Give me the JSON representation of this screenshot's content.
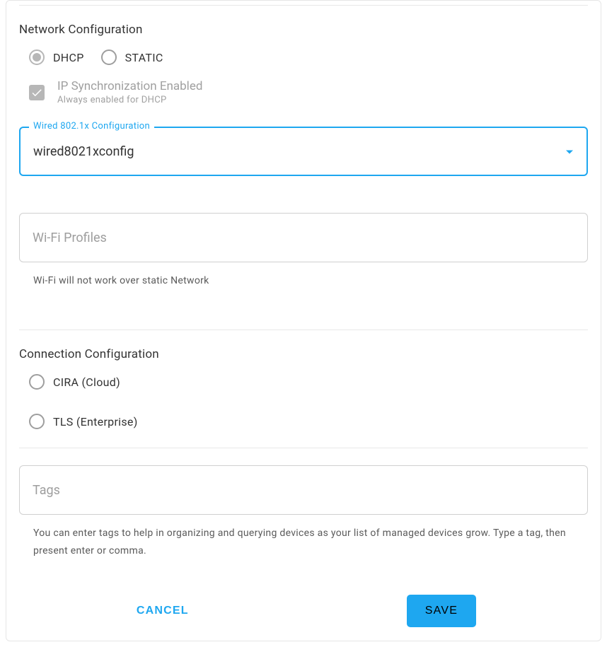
{
  "network": {
    "title": "Network Configuration",
    "options": {
      "dhcp": "DHCP",
      "static": "STATIC"
    },
    "ip_sync": {
      "label": "IP Synchronization Enabled",
      "sub": "Always enabled for DHCP"
    },
    "wired": {
      "label": "Wired 802.1x Configuration",
      "value": "wired8021xconfig"
    },
    "wifi": {
      "placeholder": "Wi-Fi Profiles",
      "helper": "Wi-Fi will not work over static Network"
    }
  },
  "connection": {
    "title": "Connection Configuration",
    "cira": "CIRA (Cloud)",
    "tls": "TLS (Enterprise)"
  },
  "tags": {
    "placeholder": "Tags",
    "helper": "You can enter tags to help in organizing and querying devices as your list of managed devices grow. Type a tag, then present enter or comma."
  },
  "actions": {
    "cancel": "CANCEL",
    "save": "SAVE"
  }
}
